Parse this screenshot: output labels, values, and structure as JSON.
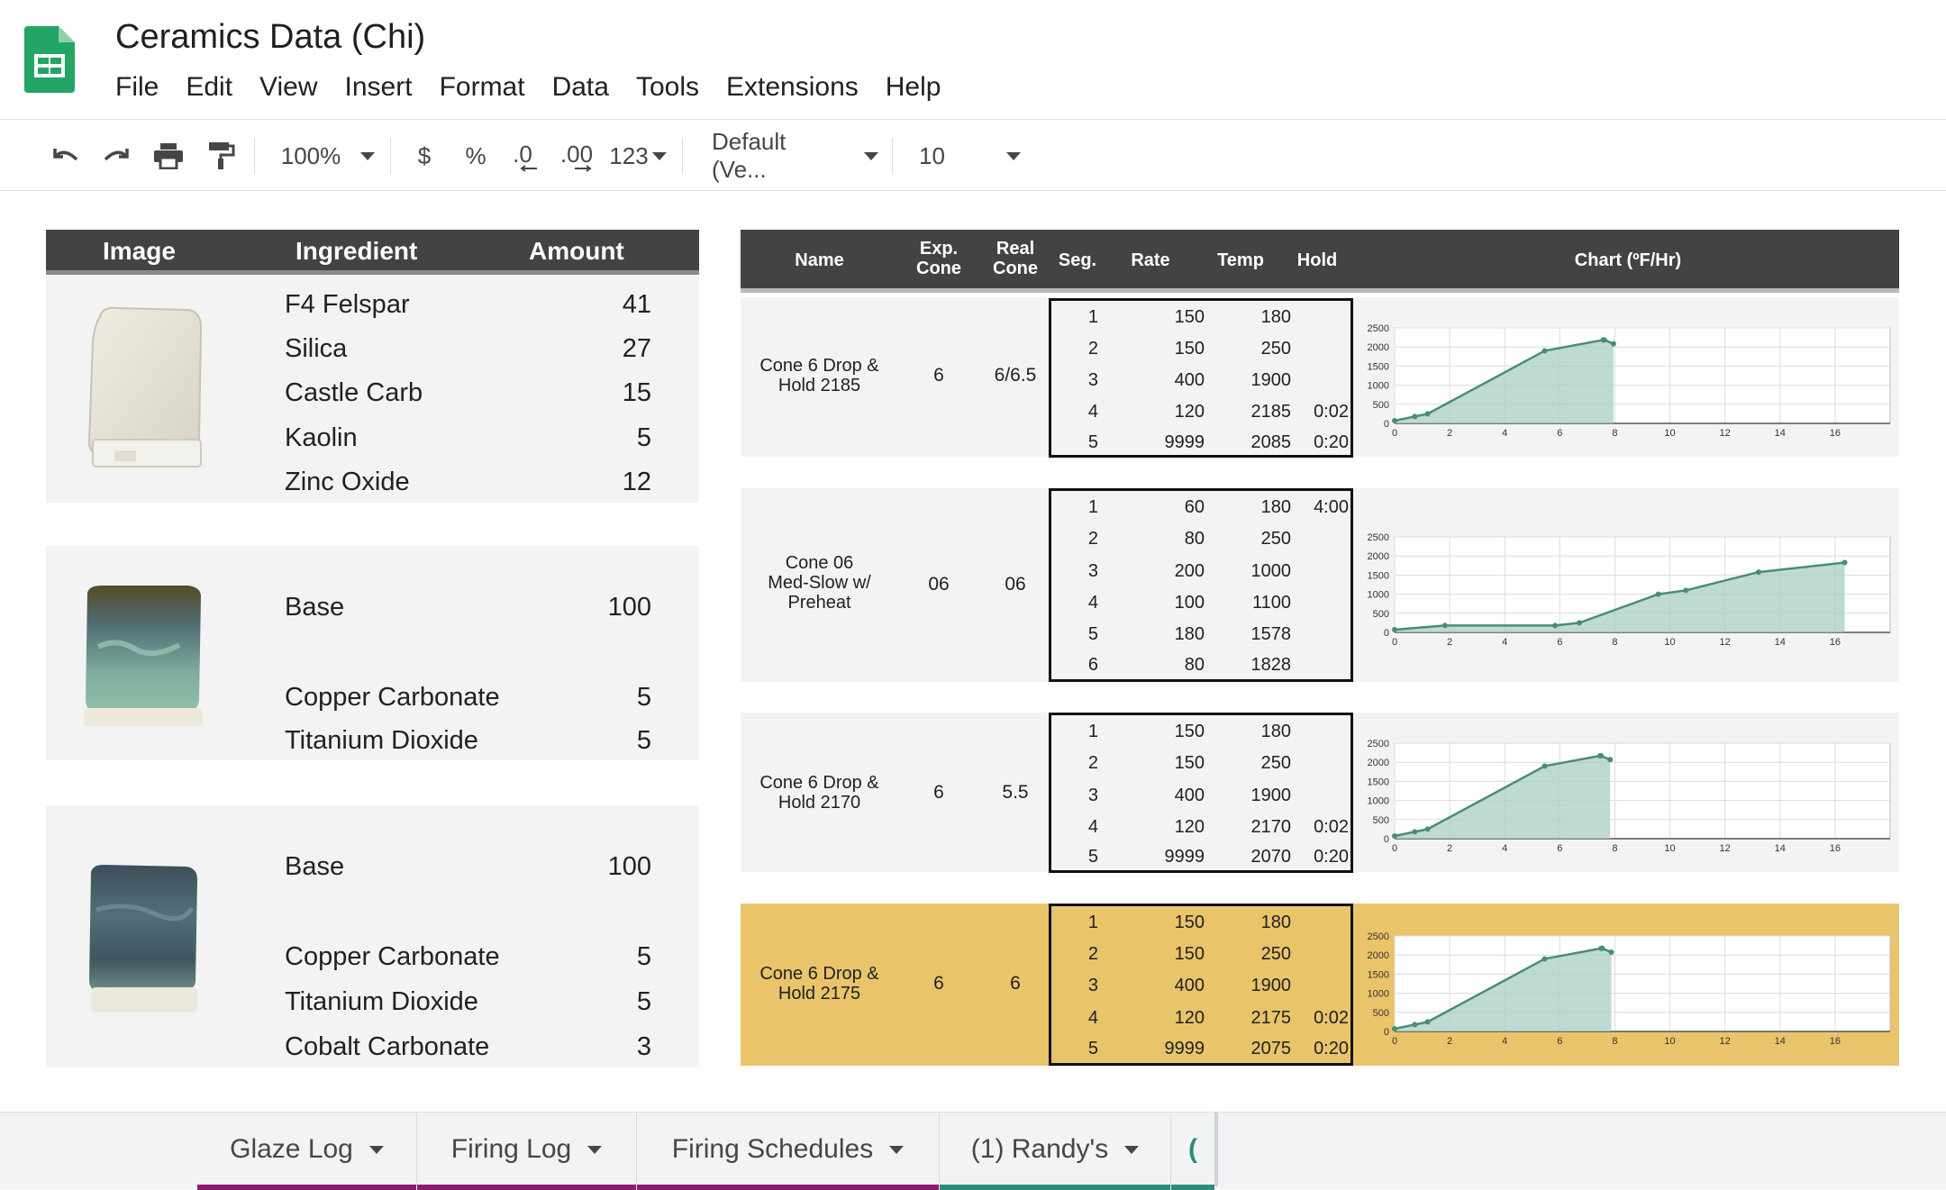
{
  "app": {
    "title": "Ceramics Data (Chi)",
    "menu": [
      "File",
      "Edit",
      "View",
      "Insert",
      "Format",
      "Data",
      "Tools",
      "Extensions",
      "Help"
    ]
  },
  "toolbar": {
    "zoom": "100%",
    "currency": "$",
    "percent": "%",
    "decrease_decimal": ".0",
    "increase_decimal": ".00",
    "more_formats": "123",
    "font": "Default (Ve...",
    "font_size": "10"
  },
  "ingredients_table": {
    "headers": [
      "Image",
      "Ingredient",
      "Amount"
    ],
    "recipes": [
      {
        "items": [
          {
            "name": "F4 Felspar",
            "amount": "41"
          },
          {
            "name": "Silica",
            "amount": "27"
          },
          {
            "name": "Castle Carb",
            "amount": "15"
          },
          {
            "name": "Kaolin",
            "amount": "5"
          },
          {
            "name": "Zinc Oxide",
            "amount": "12"
          }
        ]
      },
      {
        "items": [
          {
            "name": "Base",
            "amount": "100"
          },
          {
            "name": "Copper Carbonate",
            "amount": "5"
          },
          {
            "name": "Titanium Dioxide",
            "amount": "5"
          }
        ]
      },
      {
        "items": [
          {
            "name": "Base",
            "amount": "100"
          },
          {
            "name": "Copper Carbonate",
            "amount": "5"
          },
          {
            "name": "Titanium Dioxide",
            "amount": "5"
          },
          {
            "name": "Cobalt Carbonate",
            "amount": "3"
          }
        ]
      }
    ]
  },
  "firing_table": {
    "headers": {
      "name": "Name",
      "exp_cone_1": "Exp.",
      "exp_cone_2": "Cone",
      "real_cone_1": "Real",
      "real_cone_2": "Cone",
      "seg": "Seg.",
      "rate": "Rate",
      "temp": "Temp",
      "hold": "Hold",
      "chart": "Chart (ºF/Hr)"
    },
    "schedules": [
      {
        "name_1": "Cone 6 Drop &",
        "name_2": "Hold 2185",
        "name_3": "",
        "exp_cone": "6",
        "real_cone": "6/6.5",
        "segments": [
          {
            "seg": "1",
            "rate": "150",
            "temp": "180",
            "hold": ""
          },
          {
            "seg": "2",
            "rate": "150",
            "temp": "250",
            "hold": ""
          },
          {
            "seg": "3",
            "rate": "400",
            "temp": "1900",
            "hold": ""
          },
          {
            "seg": "4",
            "rate": "120",
            "temp": "2185",
            "hold": "0:02"
          },
          {
            "seg": "5",
            "rate": "9999",
            "temp": "2085",
            "hold": "0:20"
          }
        ]
      },
      {
        "name_1": "Cone 06",
        "name_2": "Med-Slow w/",
        "name_3": "Preheat",
        "exp_cone": "06",
        "real_cone": "06",
        "segments": [
          {
            "seg": "1",
            "rate": "60",
            "temp": "180",
            "hold": "4:00"
          },
          {
            "seg": "2",
            "rate": "80",
            "temp": "250",
            "hold": ""
          },
          {
            "seg": "3",
            "rate": "200",
            "temp": "1000",
            "hold": ""
          },
          {
            "seg": "4",
            "rate": "100",
            "temp": "1100",
            "hold": ""
          },
          {
            "seg": "5",
            "rate": "180",
            "temp": "1578",
            "hold": ""
          },
          {
            "seg": "6",
            "rate": "80",
            "temp": "1828",
            "hold": ""
          }
        ]
      },
      {
        "name_1": "Cone 6 Drop &",
        "name_2": "Hold 2170",
        "name_3": "",
        "exp_cone": "6",
        "real_cone": "5.5",
        "segments": [
          {
            "seg": "1",
            "rate": "150",
            "temp": "180",
            "hold": ""
          },
          {
            "seg": "2",
            "rate": "150",
            "temp": "250",
            "hold": ""
          },
          {
            "seg": "3",
            "rate": "400",
            "temp": "1900",
            "hold": ""
          },
          {
            "seg": "4",
            "rate": "120",
            "temp": "2170",
            "hold": "0:02"
          },
          {
            "seg": "5",
            "rate": "9999",
            "temp": "2070",
            "hold": "0:20"
          }
        ]
      },
      {
        "name_1": "Cone 6 Drop &",
        "name_2": "Hold 2175",
        "name_3": "",
        "exp_cone": "6",
        "real_cone": "6",
        "segments": [
          {
            "seg": "1",
            "rate": "150",
            "temp": "180",
            "hold": ""
          },
          {
            "seg": "2",
            "rate": "150",
            "temp": "250",
            "hold": ""
          },
          {
            "seg": "3",
            "rate": "400",
            "temp": "1900",
            "hold": ""
          },
          {
            "seg": "4",
            "rate": "120",
            "temp": "2175",
            "hold": "0:02"
          },
          {
            "seg": "5",
            "rate": "9999",
            "temp": "2075",
            "hold": "0:20"
          }
        ]
      }
    ]
  },
  "chart_data": [
    {
      "type": "area",
      "xlim": [
        0,
        18
      ],
      "ylim": [
        0,
        2500
      ],
      "xticks": [
        0,
        2,
        4,
        6,
        8,
        10,
        12,
        14,
        16
      ],
      "yticks": [
        0,
        500,
        1000,
        1500,
        2000,
        2500
      ],
      "x": [
        0,
        0.73,
        1.2,
        5.45,
        7.58,
        7.62,
        7.95
      ],
      "y": [
        70,
        180,
        250,
        1900,
        2185,
        2185,
        2085
      ]
    },
    {
      "type": "area",
      "xlim": [
        0,
        18
      ],
      "ylim": [
        0,
        2500
      ],
      "xticks": [
        0,
        2,
        4,
        6,
        8,
        10,
        12,
        14,
        16
      ],
      "yticks": [
        0,
        500,
        1000,
        1500,
        2000,
        2500
      ],
      "x": [
        0,
        1.83,
        5.83,
        6.71,
        9.58,
        10.58,
        13.22,
        16.35
      ],
      "y": [
        70,
        180,
        180,
        250,
        1000,
        1100,
        1578,
        1828
      ]
    },
    {
      "type": "area",
      "xlim": [
        0,
        18
      ],
      "ylim": [
        0,
        2500
      ],
      "xticks": [
        0,
        2,
        4,
        6,
        8,
        10,
        12,
        14,
        16
      ],
      "yticks": [
        0,
        500,
        1000,
        1500,
        2000,
        2500
      ],
      "x": [
        0,
        0.73,
        1.2,
        5.45,
        7.46,
        7.5,
        7.83
      ],
      "y": [
        70,
        180,
        250,
        1900,
        2170,
        2170,
        2070
      ]
    },
    {
      "type": "area",
      "xlim": [
        0,
        18
      ],
      "ylim": [
        0,
        2500
      ],
      "xticks": [
        0,
        2,
        4,
        6,
        8,
        10,
        12,
        14,
        16
      ],
      "yticks": [
        0,
        500,
        1000,
        1500,
        2000,
        2500
      ],
      "x": [
        0,
        0.73,
        1.2,
        5.45,
        7.5,
        7.54,
        7.87
      ],
      "y": [
        70,
        180,
        250,
        1900,
        2175,
        2175,
        2075
      ]
    }
  ],
  "sheet_tabs": [
    {
      "label": "Glaze Log",
      "color": "#8e1b6e"
    },
    {
      "label": "Firing Log",
      "color": "#8e1b6e"
    },
    {
      "label": "Firing Schedules",
      "color": "#8e1b6e"
    },
    {
      "label": "(1) Randy's",
      "color": "#2a8c7b"
    },
    {
      "label": "(",
      "color": "#2a8c7b"
    }
  ],
  "colors": {
    "header_bg": "#434343",
    "row_bg": "#f3f3f3",
    "highlight_row": "#e9c46a",
    "chart_line": "#4a8c78",
    "chart_fill": "#a9cfc2",
    "sheets_green": "#23a566"
  },
  "icons": [
    "sheets-logo-icon",
    "undo-icon",
    "redo-icon",
    "print-icon",
    "paint-format-icon",
    "chevron-down-icon"
  ]
}
